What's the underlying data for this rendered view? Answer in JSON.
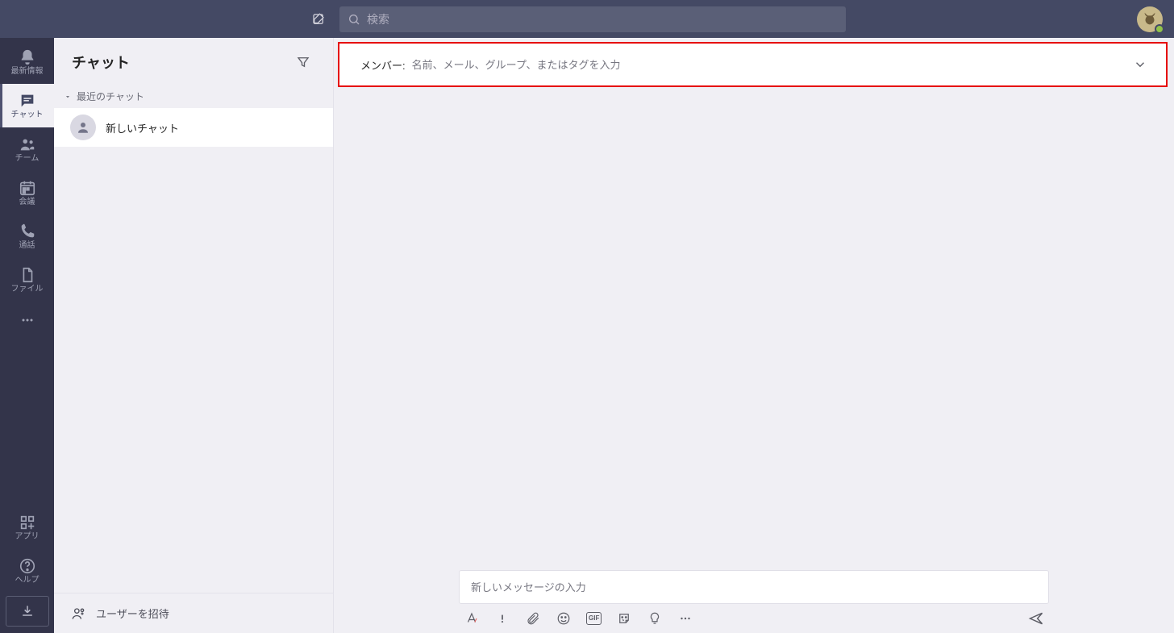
{
  "search": {
    "placeholder": "検索"
  },
  "rail": {
    "activity": "最新情報",
    "chat": "チャット",
    "teams": "チーム",
    "calendar": "会議",
    "calls": "通話",
    "files": "ファイル",
    "apps": "アプリ",
    "help": "ヘルプ"
  },
  "chatlist": {
    "title": "チャット",
    "recent_section": "最近のチャット",
    "items": [
      {
        "name": "新しいチャット"
      }
    ],
    "invite": "ユーザーを招待"
  },
  "members": {
    "label": "メンバー:",
    "placeholder": "名前、メール、グループ、またはタグを入力"
  },
  "compose": {
    "placeholder": "新しいメッセージの入力",
    "gif_label": "GIF"
  }
}
